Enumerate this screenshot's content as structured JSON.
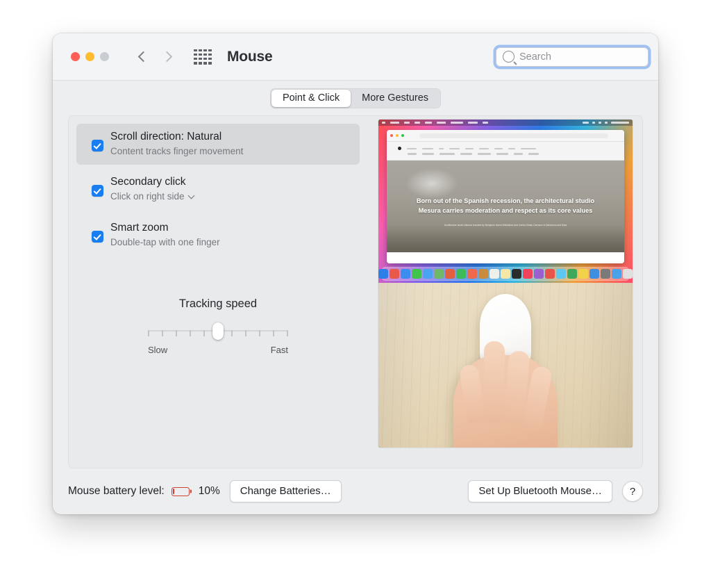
{
  "window": {
    "title": "Mouse",
    "traffic_lights": [
      "close",
      "minimize",
      "zoom"
    ],
    "nav_back": "back",
    "nav_forward": "forward",
    "show_all_icon": "grid-icon"
  },
  "search": {
    "placeholder": "Search",
    "value": "",
    "icon": "search-icon",
    "focused": true,
    "focus_ring_color": "#5a96f0"
  },
  "tabs": [
    {
      "label": "Point & Click",
      "selected": true
    },
    {
      "label": "More Gestures",
      "selected": false
    }
  ],
  "options": [
    {
      "title": "Scroll direction: Natural",
      "subtitle": "Content tracks finger movement",
      "checked": true,
      "highlighted": true,
      "has_popup": false
    },
    {
      "title": "Secondary click",
      "subtitle": "Click on right side",
      "checked": true,
      "highlighted": false,
      "has_popup": true,
      "popup_icon": "chevron-down-icon"
    },
    {
      "title": "Smart zoom",
      "subtitle": "Double-tap with one finger",
      "checked": true,
      "highlighted": false,
      "has_popup": false
    }
  ],
  "slider": {
    "label": "Tracking speed",
    "min_label": "Slow",
    "max_label": "Fast",
    "tick_count": 11,
    "value_percent": 50
  },
  "preview": {
    "screen": {
      "hero_text": "Born out of the Spanish recession, the architectural studio Mesura carries moderation and respect as its core values",
      "hero_subtext": "Architecture studio Mesura founded by Benjamin Iborra Wicksteed and Carlos Dimas Carrasco in Barcelona and Ibiza",
      "dock_colors": [
        "#2f7fe8",
        "#e8594a",
        "#3b8ef0",
        "#3fc44c",
        "#4aa3f2",
        "#6fb86a",
        "#e06040",
        "#3dbb5a",
        "#ef6a4d",
        "#c98b3e",
        "#f0f0ea",
        "#f4e7a8",
        "#2b2b2b",
        "#f0425a",
        "#9b5fd0",
        "#e8544a",
        "#5fc8f0",
        "#3fa85a",
        "#f2d24a",
        "#3f8fe0",
        "#7a7a7a",
        "#4aa3e8",
        "#e0e0e0"
      ],
      "traffic_lights": [
        "close",
        "minimize",
        "zoom"
      ]
    },
    "photo": {
      "description": "hand-on-magic-mouse-photo"
    }
  },
  "bottom": {
    "battery_label": "Mouse battery level:",
    "battery_percent": "10%",
    "battery_level": 10,
    "battery_color": "#e0342a",
    "change_batteries_label": "Change Batteries…",
    "setup_bluetooth_label": "Set Up Bluetooth Mouse…",
    "help_label": "?"
  },
  "colors": {
    "accent": "#1a7ef3",
    "window_bg": "#eceef0",
    "panel_bg": "#e8eaec",
    "titlebar_bg": "#f2f4f6"
  }
}
